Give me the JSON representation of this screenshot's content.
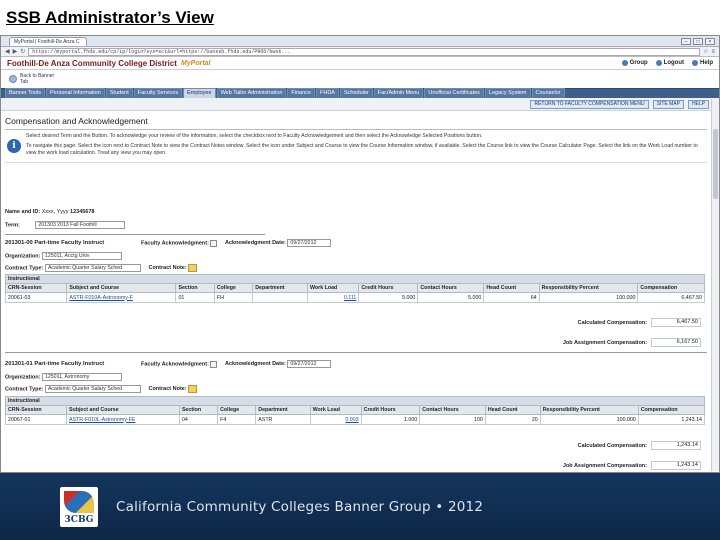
{
  "slide": {
    "title": "SSB Administrator’s View",
    "footer": "California Community Colleges Banner Group • 2012",
    "logo_text": "3CBG"
  },
  "browser": {
    "tab_label": "MyPortal | Foothill-De Anza C",
    "url": "https://myportal.fhda.edu/cp/ip/login?sys=sct&url=https://banssb.fhda.edu/PROD/bwsk..."
  },
  "portal": {
    "institution": "Foothill-De Anza Community College District",
    "brand": "MyPortal",
    "utils": {
      "group": "Group",
      "logout": "Logout",
      "help": "Help"
    },
    "back_label": "Back to Banner Tab"
  },
  "nav_tabs": [
    "Banner Tools",
    "Personal Information",
    "Student",
    "Faculty Services",
    "Employee",
    "Web Tailor Administration",
    "Finance",
    "FHDA",
    "Scheduler",
    "Fac/Admin Menu",
    "Unofficial Certificates",
    "Legacy System",
    "Counselor"
  ],
  "nav_active_index": 4,
  "subbar": {
    "return_btn": "RETURN TO FACULTY COMPENSATION MENU",
    "sitemap_btn": "SITE MAP",
    "help_btn": "HELP"
  },
  "page": {
    "heading": "Compensation and Acknowledgement",
    "info1": "Select desired Term and the Button. To acknowledge your review of the information, select the checkbox next to Faculty Acknowledgement and then select the Acknowledge Selected Positions button.",
    "info2": "To navigate this page: Select the icon next to Contract Note to view the Contract Notes window. Select the icon under Subject and Course to view the Course Information window, if available. Select the Course link to view the Course Calculator Page. Select the link on the Work Load number to view the work load calculation. Treat any view you may open.",
    "name_label": "Name and ID:",
    "name_value": "Xxxx, Yyyy",
    "id_value": "12345678",
    "term_label": "Term:",
    "term_value": "201303",
    "term_desc": "2013 Fall Foothill"
  },
  "sections": [
    {
      "title": "201301-00 Part-time Faculty Instruct",
      "fac_ack_label": "Faculty Acknowledgment:",
      "ack_date_label": "Acknowledgment Date:",
      "ack_date": "09/27/2012",
      "org_label": "Organization:",
      "org_value": "125011, Acctg Univ",
      "ctype_label": "Contract Type:",
      "ctype_value": "Academic Quarter Salary Sched",
      "cnote_label": "Contract Note:",
      "group": "Instructional",
      "headers": [
        "CRN-Session",
        "Subject and Course",
        "Section",
        "College",
        "Department",
        "Work Load",
        "Credit Hours",
        "Contact Hours",
        "Head Count",
        "Responsibility Percent",
        "Compensation"
      ],
      "rows": [
        [
          "20061-03",
          "ASTR-F010A-Astronomy-F",
          "01",
          "FH",
          "",
          "0.111",
          "5.000",
          "5.000",
          "64",
          "100.000",
          "6,467.50"
        ]
      ],
      "calc_label": "Calculated Compensation:",
      "calc_value": "6,467.50",
      "job_label": "Job Assignment Compensation:",
      "job_value": "6,167.50"
    },
    {
      "title": "201301-01 Part-time Faculty Instruct",
      "fac_ack_label": "Faculty Acknowledgment:",
      "ack_date_label": "Acknowledgment Date:",
      "ack_date": "09/27/2012",
      "org_label": "Organization:",
      "org_value": "125011, Astronomy",
      "ctype_label": "Contract Type:",
      "ctype_value": "Academic Quarter Salary Sched",
      "cnote_label": "Contract Note:",
      "group": "Instructional",
      "headers": [
        "CRN-Session",
        "Subject and Course",
        "Section",
        "College",
        "Department",
        "Work Load",
        "Credit Hours",
        "Contact Hours",
        "Head Count",
        "Responsibility Percent",
        "Compensation"
      ],
      "rows": [
        [
          "20067-01",
          "ASTR-F010L-Astronomy-FE",
          "04",
          "F4",
          "ASTR",
          "0.003",
          "1.000",
          "100",
          "20",
          "100.000",
          "1,243.14"
        ]
      ],
      "calc_label": "Calculated Compensation:",
      "calc_value": "1,243.14",
      "job_label": "Job Assignment Compensation:",
      "job_value": "1,243.14"
    }
  ]
}
